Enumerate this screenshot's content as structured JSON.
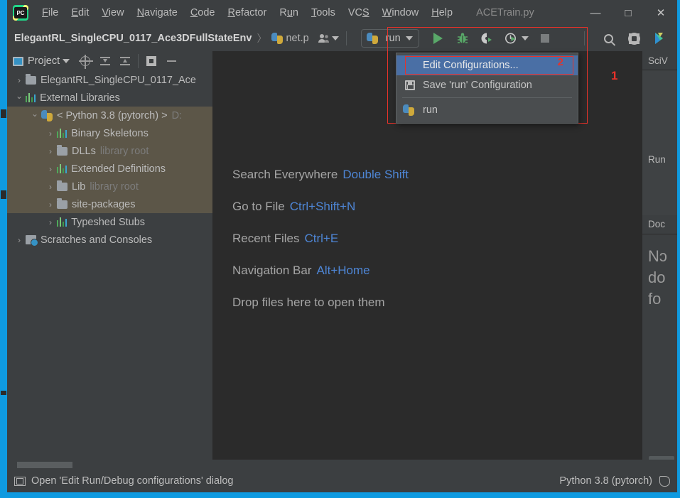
{
  "window": {
    "title": "ACETrain.py",
    "controls": {
      "minimize": "—",
      "maximize": "□",
      "close": "✕"
    }
  },
  "menubar": {
    "logo_text": "PC",
    "items": [
      {
        "label": "File",
        "mnemonic": "F"
      },
      {
        "label": "Edit",
        "mnemonic": "E"
      },
      {
        "label": "View",
        "mnemonic": "V"
      },
      {
        "label": "Navigate",
        "mnemonic": "N"
      },
      {
        "label": "Code",
        "mnemonic": "C"
      },
      {
        "label": "Refactor",
        "mnemonic": "R"
      },
      {
        "label": "Run",
        "mnemonic": "u"
      },
      {
        "label": "Tools",
        "mnemonic": "T"
      },
      {
        "label": "VCS",
        "mnemonic": "S"
      },
      {
        "label": "Window",
        "mnemonic": "W"
      },
      {
        "label": "Help",
        "mnemonic": "H"
      }
    ]
  },
  "navbar": {
    "project_crumb": "ElegantRL_SingleCPU_0117_Ace3DFullStateEnv",
    "separator": "〉",
    "file_crumb": "net.p",
    "run_config_name": "run",
    "icons": {
      "vcs_user": "user-group-icon",
      "run": "run-icon",
      "debug": "debug-icon",
      "coverage": "coverage-icon",
      "profile": "profile-icon",
      "stop": "stop-icon",
      "search": "search-icon",
      "settings": "settings-icon",
      "datashare": "datashare-icon"
    }
  },
  "annotations": {
    "step1": "1",
    "step2": "2"
  },
  "run_menu": {
    "items": [
      {
        "label": "Edit Configurations...",
        "icon": "none",
        "selected": true
      },
      {
        "label": "Save 'run' Configuration",
        "icon": "save-icon",
        "selected": false
      },
      {
        "label": "run",
        "icon": "python-icon",
        "selected": false
      }
    ]
  },
  "project_panel": {
    "title": "Project",
    "toolbar": [
      "locate-icon",
      "expand-all-icon",
      "collapse-all-icon",
      "gear-icon",
      "hide-icon"
    ],
    "tree": [
      {
        "label": "ElegantRL_SingleCPU_0117_Ace",
        "suffix": "",
        "icon": "folder-icon",
        "arrow": "›",
        "indent": 0,
        "selected": false
      },
      {
        "label": "External Libraries",
        "suffix": "",
        "icon": "library-icon",
        "arrow": "⌄",
        "indent": 0,
        "selected": false
      },
      {
        "label": "< Python 3.8 (pytorch) >",
        "suffix": "D:",
        "icon": "python-icon",
        "arrow": "⌄",
        "indent": 1,
        "selected": true
      },
      {
        "label": "Binary Skeletons",
        "suffix": "",
        "icon": "library-icon",
        "arrow": "›",
        "indent": 2,
        "selected": true
      },
      {
        "label": "DLLs",
        "suffix": "library root",
        "icon": "folder-icon",
        "arrow": "›",
        "indent": 2,
        "selected": true
      },
      {
        "label": "Extended Definitions",
        "suffix": "",
        "icon": "library-icon",
        "arrow": "›",
        "indent": 2,
        "selected": true
      },
      {
        "label": "Lib",
        "suffix": "library root",
        "icon": "folder-icon",
        "arrow": "›",
        "indent": 2,
        "selected": true
      },
      {
        "label": "site-packages",
        "suffix": "",
        "icon": "folder-icon",
        "arrow": "›",
        "indent": 2,
        "selected": true
      },
      {
        "label": "Typeshed Stubs",
        "suffix": "",
        "icon": "library-icon",
        "arrow": "›",
        "indent": 2,
        "selected": false
      },
      {
        "label": "Scratches and Consoles",
        "suffix": "",
        "icon": "scratches-icon",
        "arrow": "›",
        "indent": 0,
        "selected": false
      }
    ]
  },
  "editor": {
    "hints": [
      {
        "label": "Search Everywhere",
        "key": "Double Shift"
      },
      {
        "label": "Go to File",
        "key": "Ctrl+Shift+N"
      },
      {
        "label": "Recent Files",
        "key": "Ctrl+E"
      },
      {
        "label": "Navigation Bar",
        "key": "Alt+Home"
      },
      {
        "label": "Drop files here to open them",
        "key": ""
      }
    ]
  },
  "right_panel": {
    "sciview_tab": "SciV",
    "run_label": "Run ",
    "documentation_tab": "Doc",
    "doc_text_lines": [
      "Nɔ",
      "do",
      "fo"
    ]
  },
  "statusbar": {
    "message": "Open 'Edit Run/Debug configurations' dialog",
    "interpreter": "Python 3.8 (pytorch)"
  },
  "colors": {
    "accent_blue": "#0f9ae0",
    "panel": "#3c3f41",
    "editor": "#2b2b2b",
    "selection": "#4a6fa5",
    "tree_selection": "#5c5648",
    "annotation_red": "#e8322a",
    "hint_key": "#4e86d6",
    "run_green": "#59a869"
  }
}
